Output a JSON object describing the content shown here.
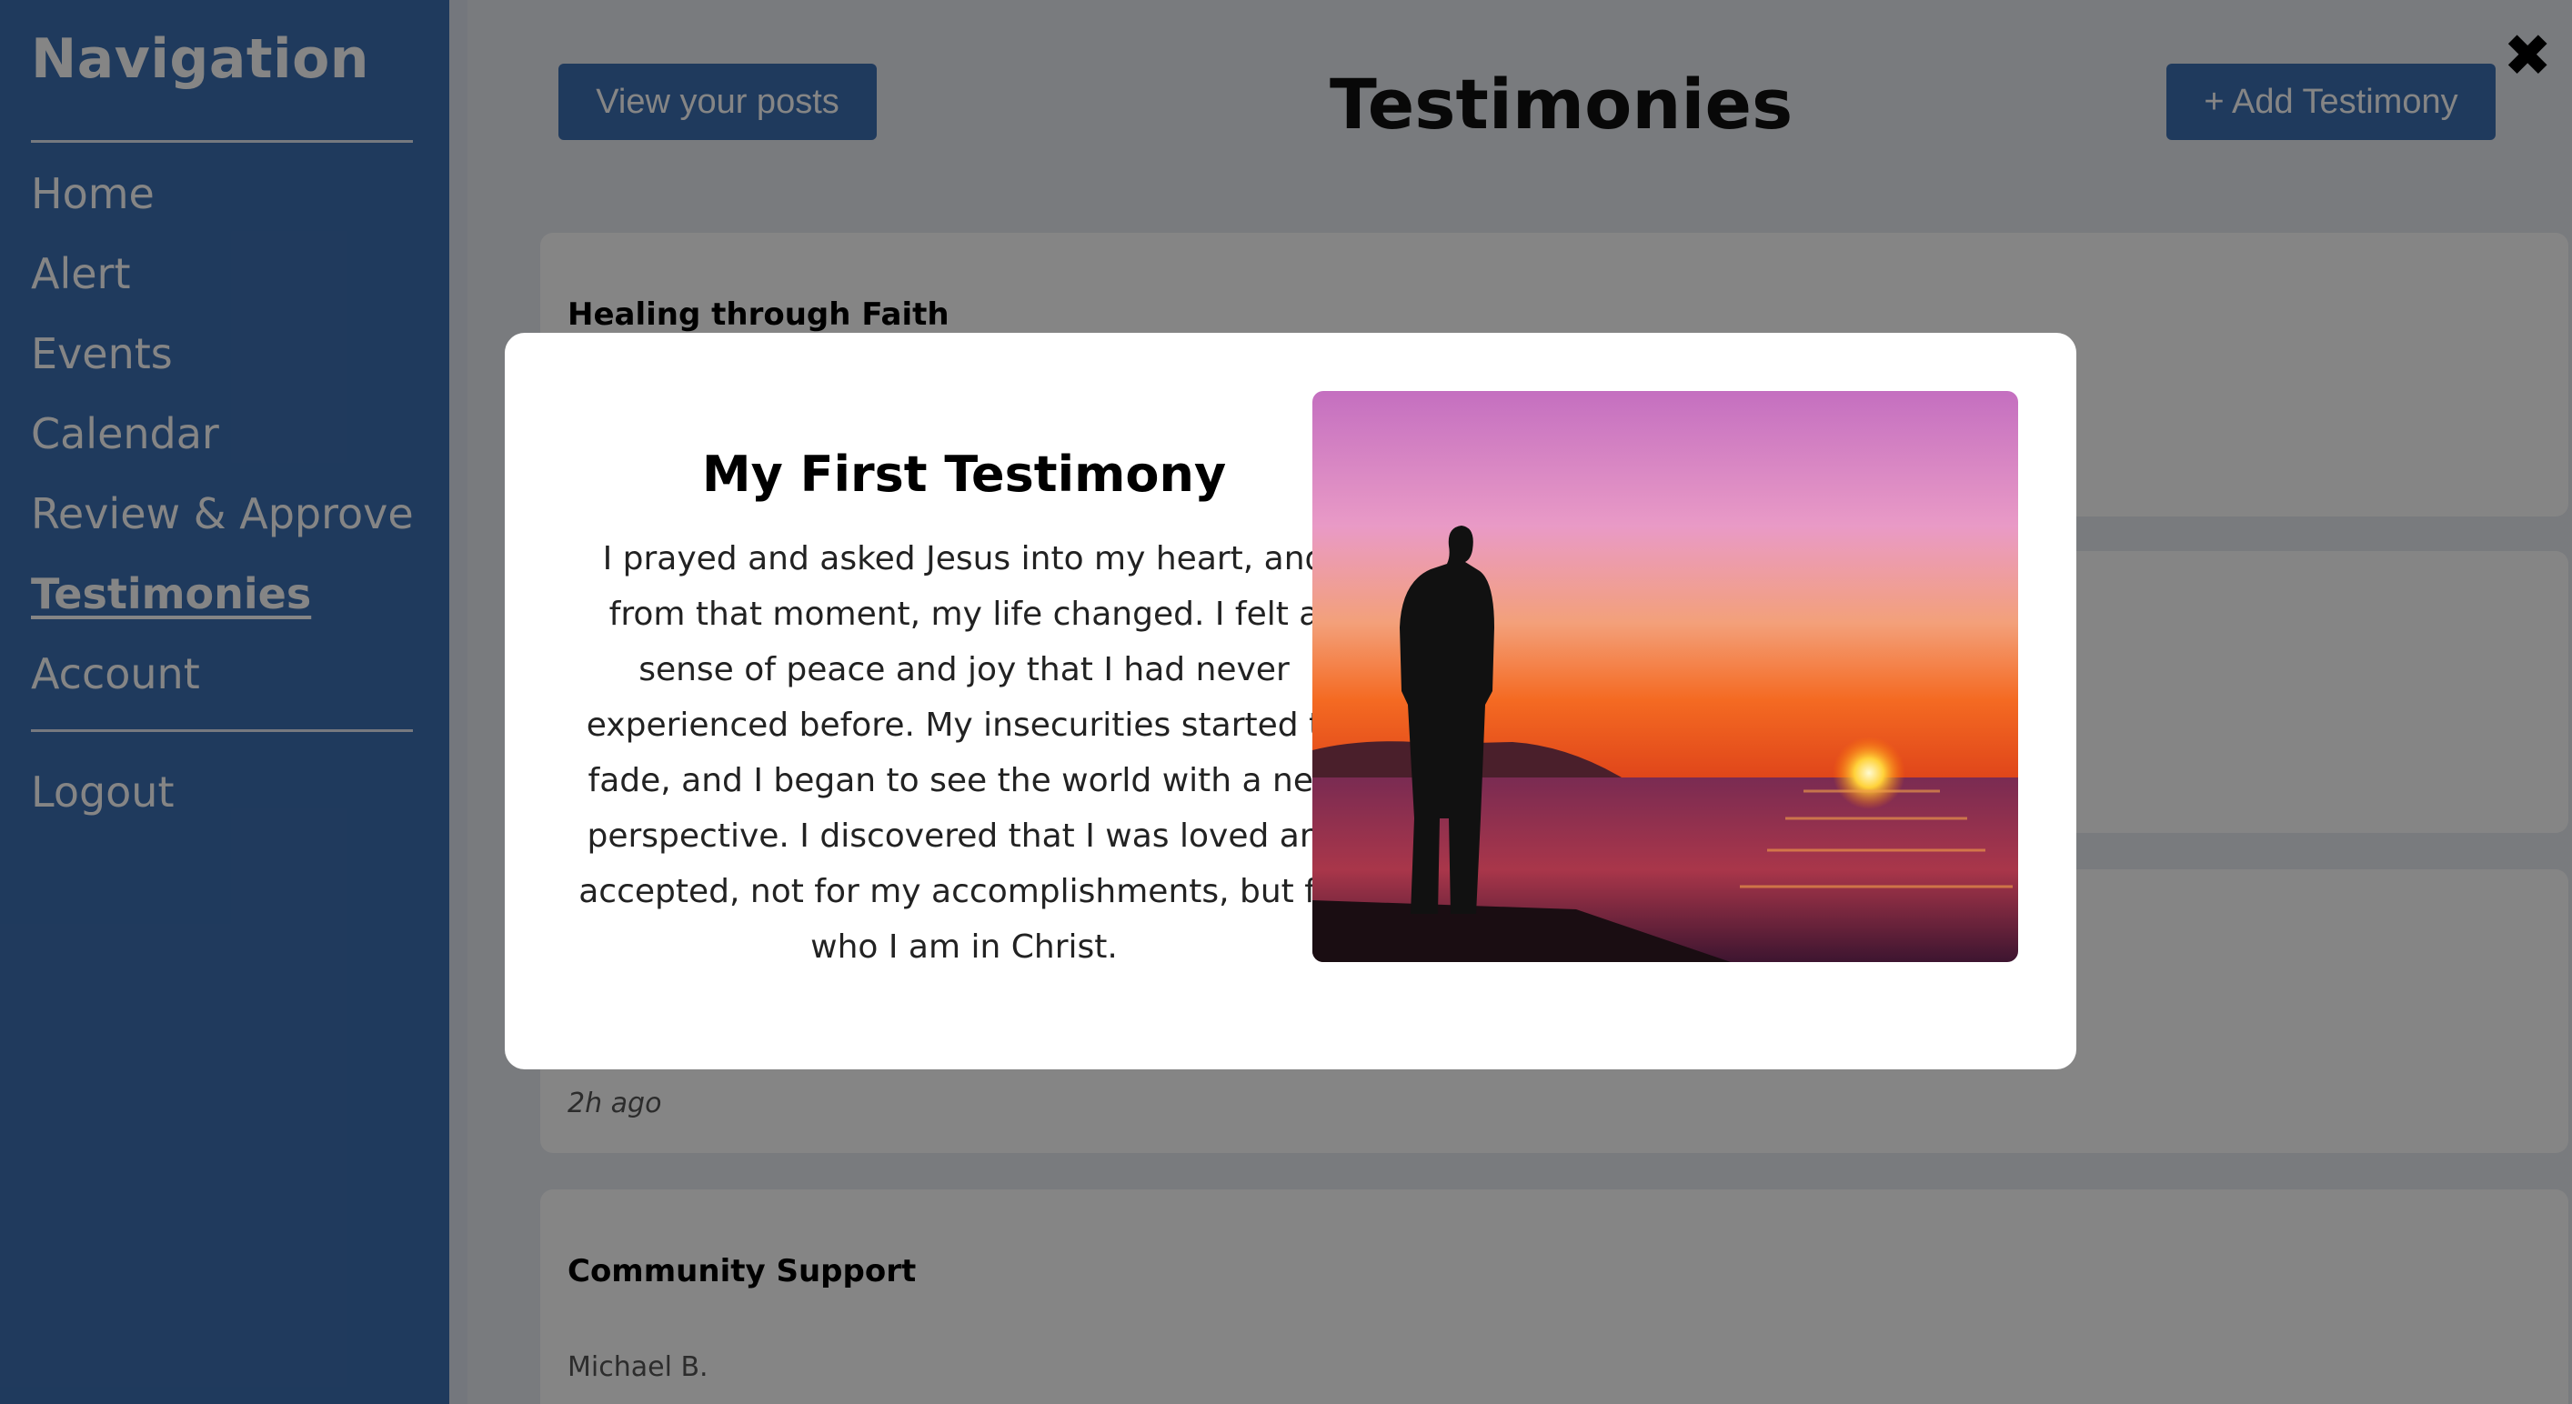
{
  "sidebar": {
    "title": "Navigation",
    "items": [
      {
        "label": "Home"
      },
      {
        "label": "Alert"
      },
      {
        "label": "Events"
      },
      {
        "label": "Calendar"
      },
      {
        "label": "Review & Approve"
      },
      {
        "label": "Testimonies",
        "active": true
      },
      {
        "label": "Account"
      }
    ],
    "logout": "Logout"
  },
  "header": {
    "view_posts": "View your posts",
    "title": "Testimonies",
    "add": "+ Add Testimony",
    "close_icon": "close-icon"
  },
  "cards": [
    {
      "title": "Healing through Faith"
    },
    {
      "meta": "2h ago"
    },
    {
      "title": "Community Support",
      "author": "Michael B."
    }
  ],
  "modal": {
    "title": "My First Testimony",
    "body": "I prayed and asked Jesus into my heart, and from that moment, my life changed. I felt a sense of peace and joy that I had never experienced before. My insecurities started to fade, and I began to see the world with a new perspective. I discovered that I was loved and accepted, not for my accomplishments, but for who I am in Christ.",
    "image": "sunset-silhouette-photo"
  },
  "colors": {
    "accent": "#3d6fb2",
    "overlay": "rgba(0,0,0,0.48)"
  }
}
